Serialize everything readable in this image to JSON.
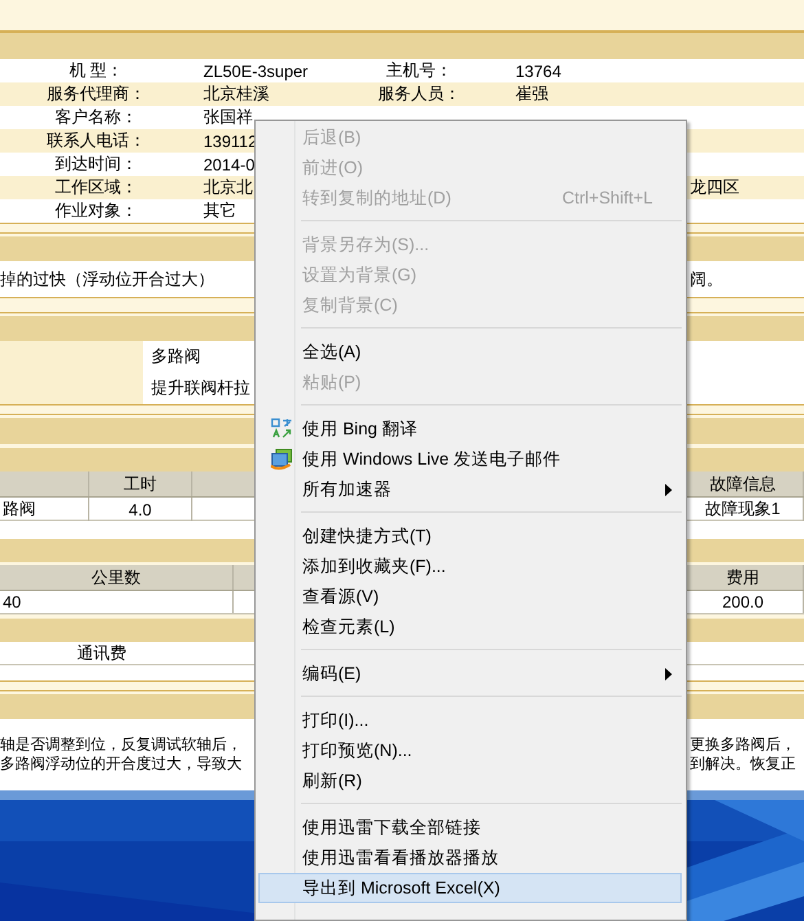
{
  "info_rows": [
    {
      "label": "机 型：",
      "value": "ZL50E-3super",
      "label2": "主机号：",
      "value2": "13764"
    },
    {
      "label": "服务代理商：",
      "value": "北京桂溪",
      "label2": "服务人员：",
      "value2": "崔强"
    },
    {
      "label": "客户名称：",
      "value": "张国祥"
    },
    {
      "label": "联系人电话：",
      "value": "139112"
    },
    {
      "label": "到达时间：",
      "value": "2014-0"
    },
    {
      "label": "工作区域：",
      "value": "北京北",
      "tail": "龙四区"
    },
    {
      "label": "作业对象：",
      "value": "其它"
    }
  ],
  "fault": {
    "text": "掉的过快（浮动位开合过大）",
    "tail": "阔。"
  },
  "parts": [
    "多路阀",
    "提升联阀杆拉"
  ],
  "work_table": {
    "columns": [
      "工时",
      "故障信息"
    ],
    "row": [
      "路阀",
      "4.0",
      "故障现象1"
    ]
  },
  "mileage_table": {
    "columns": [
      "公里数",
      "费用"
    ],
    "row": [
      "40",
      "200.0"
    ]
  },
  "fee_item": "通讯费",
  "remarks": {
    "left": [
      "轴是否调整到位，反复调试软轴后，",
      "多路阀浮动位的开合度过大，导致大"
    ],
    "right": [
      "更换多路阀后，",
      "到解决。恢复正"
    ]
  },
  "menu": {
    "items": [
      {
        "kind": "item",
        "label": "后退(B)",
        "disabled": true,
        "selected": false
      },
      {
        "kind": "item",
        "label": "前进(O)",
        "disabled": true,
        "selected": false
      },
      {
        "kind": "item",
        "label": "转到复制的地址(D)",
        "shortcut": "Ctrl+Shift+L",
        "disabled": true,
        "selected": false
      },
      {
        "kind": "separator"
      },
      {
        "kind": "item",
        "label": "背景另存为(S)...",
        "disabled": true,
        "selected": false
      },
      {
        "kind": "item",
        "label": "设置为背景(G)",
        "disabled": true,
        "selected": false
      },
      {
        "kind": "item",
        "label": "复制背景(C)",
        "disabled": true,
        "selected": false
      },
      {
        "kind": "separator"
      },
      {
        "kind": "item",
        "label": "全选(A)",
        "disabled": false,
        "selected": false
      },
      {
        "kind": "item",
        "label": "粘贴(P)",
        "disabled": true,
        "selected": false
      },
      {
        "kind": "separator"
      },
      {
        "kind": "icon_item",
        "label": "使用 Bing 翻译",
        "disabled": false,
        "selected": false
      },
      {
        "kind": "icon_item",
        "label": "使用 Windows Live 发送电子邮件",
        "disabled": false,
        "selected": false
      },
      {
        "kind": "item",
        "label": "所有加速器",
        "submenu": true,
        "disabled": false,
        "selected": false
      },
      {
        "kind": "separator"
      },
      {
        "kind": "item",
        "label": "创建快捷方式(T)",
        "disabled": false,
        "selected": false
      },
      {
        "kind": "item",
        "label": "添加到收藏夹(F)...",
        "disabled": false,
        "selected": false
      },
      {
        "kind": "item",
        "label": "查看源(V)",
        "disabled": false,
        "selected": false
      },
      {
        "kind": "item",
        "label": "检查元素(L)",
        "disabled": false,
        "selected": false
      },
      {
        "kind": "separator"
      },
      {
        "kind": "item",
        "label": "编码(E)",
        "submenu": true,
        "disabled": false,
        "selected": false
      },
      {
        "kind": "separator"
      },
      {
        "kind": "item",
        "label": "打印(I)...",
        "disabled": false,
        "selected": false
      },
      {
        "kind": "item",
        "label": "打印预览(N)...",
        "disabled": false,
        "selected": false
      },
      {
        "kind": "item",
        "label": "刷新(R)",
        "disabled": false,
        "selected": false
      },
      {
        "kind": "separator"
      },
      {
        "kind": "item",
        "label": "使用迅雷下载全部链接",
        "disabled": false,
        "selected": false
      },
      {
        "kind": "item",
        "label": "使用迅雷看看播放器播放",
        "disabled": false,
        "selected": false
      },
      {
        "kind": "item",
        "label": "导出到 Microsoft Excel(X)",
        "disabled": false,
        "selected": true
      }
    ]
  }
}
